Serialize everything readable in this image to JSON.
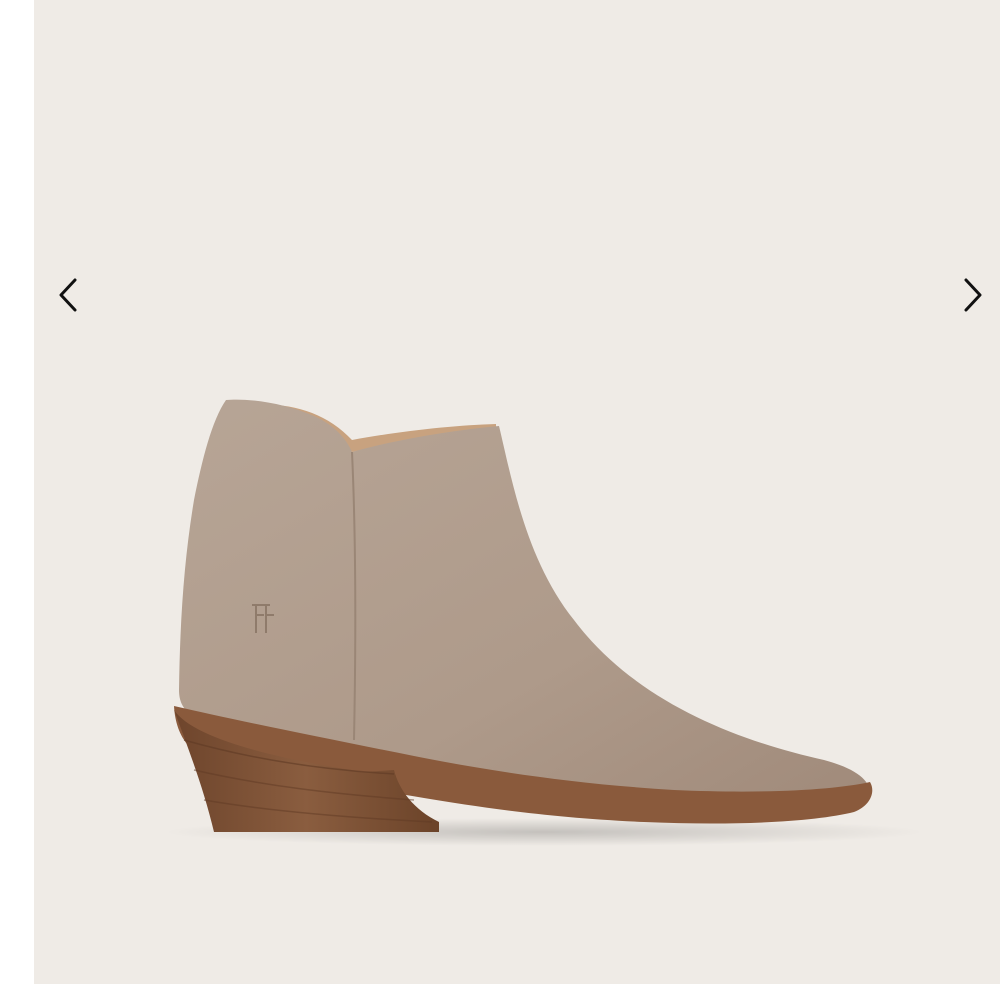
{
  "gallery": {
    "background_color": "#efebe6",
    "prev_icon": "chevron-left-icon",
    "next_icon": "chevron-right-icon",
    "image": {
      "subject": "ankle-boot",
      "colors": {
        "suede": "#b19d8d",
        "suede_shadow": "#9c8878",
        "sole": "#8a5a3c",
        "heel": "#7b5236",
        "lining": "#c8a27f"
      }
    }
  }
}
